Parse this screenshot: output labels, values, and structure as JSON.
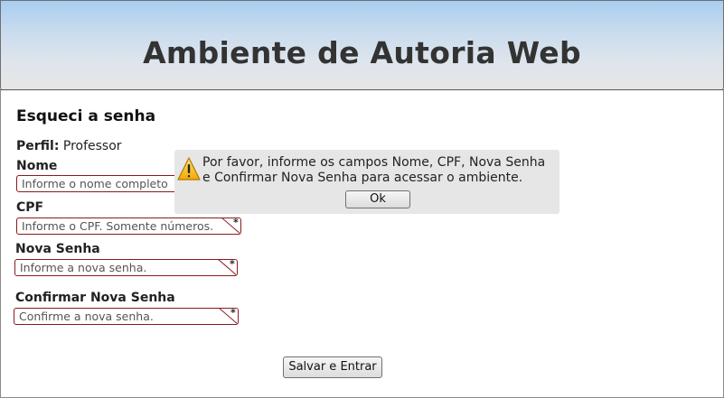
{
  "header": {
    "title": "Ambiente de Autoria Web"
  },
  "page": {
    "title": "Esqueci a senha",
    "perfil_label": "Perfil:",
    "perfil_value": "Professor"
  },
  "form": {
    "nome_label": "Nome",
    "nome_placeholder": "Informe o nome completo",
    "cpf_label": "CPF",
    "cpf_placeholder": "Informe o CPF. Somente números.",
    "senha_label": "Nova Senha",
    "senha_placeholder": "Informe a nova senha.",
    "confirmar_label": "Confirmar Nova Senha",
    "confirmar_placeholder": "Confirme a nova senha.",
    "submit_label": "Salvar e Entrar"
  },
  "alert": {
    "icon": "warning-icon",
    "message": "Por favor, informe os campos Nome, CPF, Nova Senha e Confirmar Nova Senha para acessar o ambiente.",
    "ok_label": "Ok"
  },
  "colors": {
    "field_border": "#8b1a1a",
    "header_top": "#a9cdf0",
    "warning": "#f5b800"
  }
}
